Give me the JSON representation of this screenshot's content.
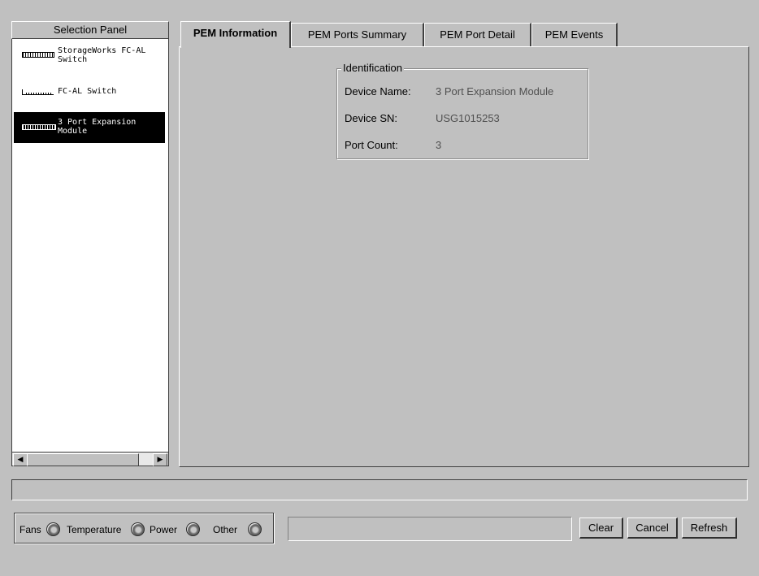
{
  "selection_panel": {
    "header": "Selection Panel",
    "items": [
      {
        "label": "StorageWorks FC-AL\nSwitch",
        "icon": "switch-device-icon",
        "selected": false
      },
      {
        "label": "FC-AL Switch",
        "icon": "switch-small-icon",
        "selected": false
      },
      {
        "label": "3 Port Expansion\nModule",
        "icon": "expansion-module-icon",
        "selected": true
      }
    ],
    "scroll_left": "◀",
    "scroll_right": "▶"
  },
  "tabs": [
    {
      "label": "PEM Information",
      "active": true
    },
    {
      "label": "PEM Ports Summary",
      "active": false
    },
    {
      "label": "PEM Port Detail",
      "active": false
    },
    {
      "label": "PEM Events",
      "active": false
    }
  ],
  "identification": {
    "title": "Identification",
    "rows": [
      {
        "label": "Device Name:",
        "value": "3 Port Expansion Module"
      },
      {
        "label": "Device SN:",
        "value": "USG1015253"
      },
      {
        "label": "Port Count:",
        "value": "3"
      }
    ]
  },
  "status_bar": {
    "text": ""
  },
  "indicators": [
    {
      "label": "Fans",
      "state": "off"
    },
    {
      "label": "Temperature",
      "state": "off"
    },
    {
      "label": "Power",
      "state": "off"
    },
    {
      "label": "Other",
      "state": "off"
    }
  ],
  "message": {
    "text": ""
  },
  "buttons": {
    "clear": "Clear",
    "cancel": "Cancel",
    "refresh": "Refresh"
  }
}
